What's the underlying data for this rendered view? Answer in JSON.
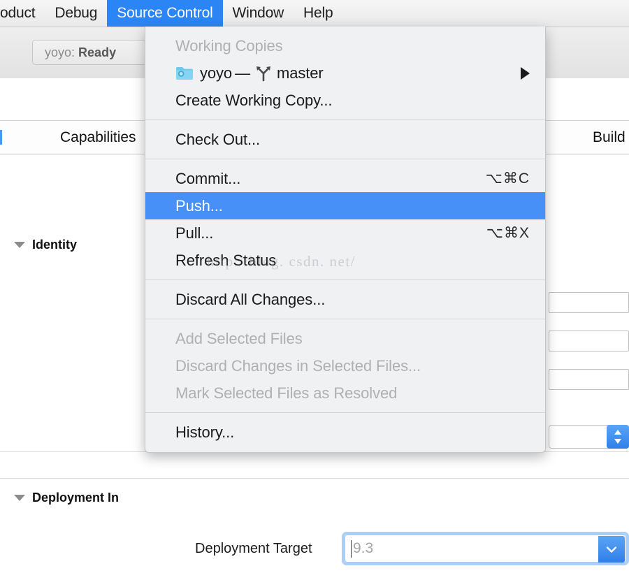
{
  "menubar": {
    "items": [
      {
        "label": "oduct",
        "active": false,
        "clipped": true
      },
      {
        "label": "Debug",
        "active": false
      },
      {
        "label": "Source Control",
        "active": true
      },
      {
        "label": "Window",
        "active": false
      },
      {
        "label": "Help",
        "active": false
      }
    ]
  },
  "toolbar": {
    "status_prefix": "yoyo:",
    "status_state": "Ready"
  },
  "editor": {
    "tabs": [
      {
        "label": "Capabilities"
      },
      {
        "label": "Build"
      }
    ],
    "sections": [
      {
        "label": "Identity"
      },
      {
        "label": "Deployment In"
      }
    ],
    "deployment_target": {
      "label": "Deployment Target",
      "value": "9.3"
    }
  },
  "menu": {
    "title": "Source Control",
    "groups": [
      {
        "items": [
          {
            "label": "Working Copies",
            "disabled": true,
            "shortcut": ""
          },
          {
            "label": "yoyo",
            "separator_text": "—",
            "branch": "master",
            "icon": "folder-icon",
            "branch_icon": "git-branch-icon",
            "submenu": true,
            "disabled": false
          },
          {
            "label": "Create Working Copy...",
            "disabled": false,
            "shortcut": ""
          }
        ]
      },
      {
        "items": [
          {
            "label": "Check Out...",
            "disabled": false,
            "shortcut": ""
          }
        ]
      },
      {
        "items": [
          {
            "label": "Commit...",
            "disabled": false,
            "shortcut": "⌥⌘C"
          },
          {
            "label": "Push...",
            "disabled": false,
            "shortcut": "",
            "selected": true
          },
          {
            "label": "Pull...",
            "disabled": false,
            "shortcut": "⌥⌘X"
          },
          {
            "label": "Refresh Status",
            "disabled": false,
            "shortcut": ""
          }
        ]
      },
      {
        "items": [
          {
            "label": "Discard All Changes...",
            "disabled": false,
            "shortcut": ""
          }
        ]
      },
      {
        "items": [
          {
            "label": "Add Selected Files",
            "disabled": true,
            "shortcut": ""
          },
          {
            "label": "Discard Changes in Selected Files...",
            "disabled": true,
            "shortcut": ""
          },
          {
            "label": "Mark Selected Files as Resolved",
            "disabled": true,
            "shortcut": ""
          }
        ]
      },
      {
        "items": [
          {
            "label": "History...",
            "disabled": false,
            "shortcut": ""
          }
        ]
      }
    ]
  },
  "watermark": {
    "text": "http://blog. csdn. net/"
  },
  "colors": {
    "menu_highlight": "#4690f7",
    "menubar_highlight": "#2b85f5",
    "menu_background": "#f0f1f3",
    "stepper_blue": "#2f7fe8",
    "disabled_text": "#b0b0b0"
  }
}
